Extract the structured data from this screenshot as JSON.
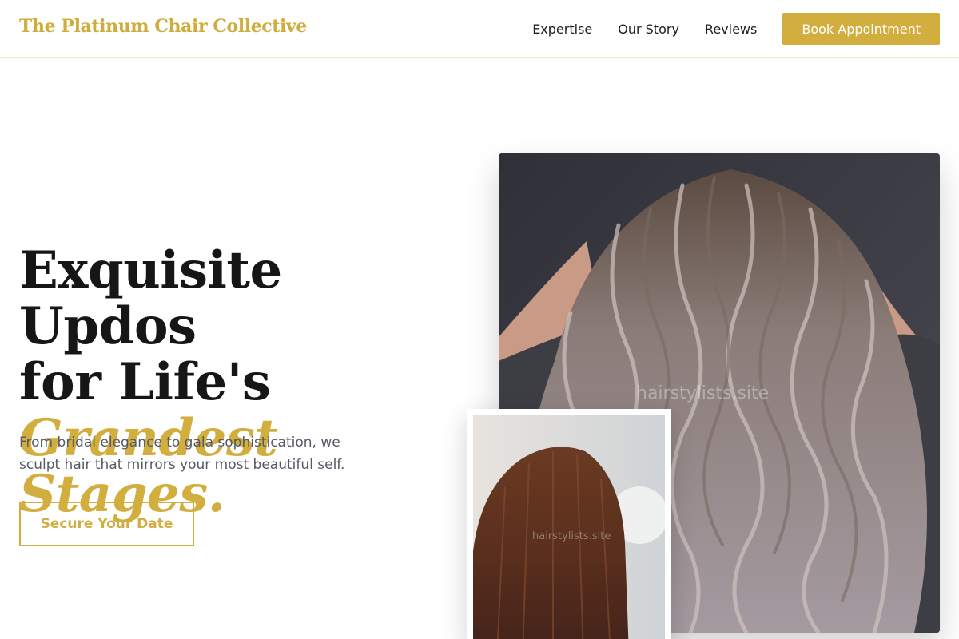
{
  "brand": "The Platinum Chair Collective",
  "nav": {
    "links": [
      "Expertise",
      "Our Story",
      "Reviews"
    ],
    "cta": "Book Appointment"
  },
  "hero": {
    "title_line1": "Exquisite Updos",
    "title_line2": "for Life's",
    "title_accent": "Grandest Stages.",
    "subtitle": "From bridal elegance to gala sophistication, we sculpt hair that mirrors your most beautiful self.",
    "cta": "Secure Your Date"
  },
  "images": {
    "main_watermark": "hairstylists.site",
    "small_watermark": "hairstylists.site"
  },
  "colors": {
    "accent": "#d2ae3f",
    "text": "#161616",
    "muted": "#555a66"
  }
}
